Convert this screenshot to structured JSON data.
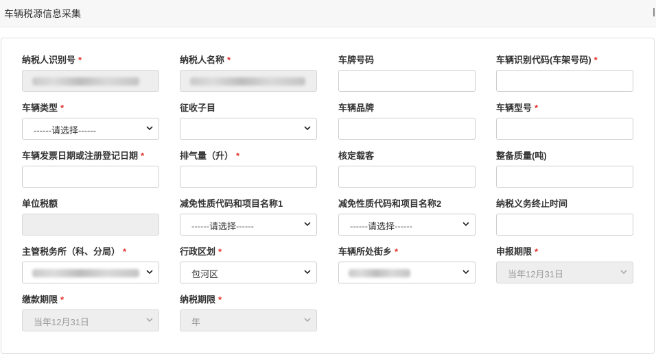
{
  "header": {
    "title": "车辆税源信息采集"
  },
  "required_mark": "*",
  "fields": {
    "taxpayer_id": {
      "label": "纳税人识别号",
      "required": true
    },
    "taxpayer_name": {
      "label": "纳税人名称",
      "required": true
    },
    "plate_no": {
      "label": "车牌号码",
      "required": false
    },
    "vin": {
      "label": "车辆识别代码(车架号码)",
      "required": true
    },
    "vehicle_type": {
      "label": "车辆类型",
      "required": true,
      "value": "------请选择------"
    },
    "levy_sub_item": {
      "label": "征收子目",
      "required": false,
      "value": ""
    },
    "vehicle_brand": {
      "label": "车辆品牌",
      "required": false
    },
    "vehicle_model": {
      "label": "车辆型号",
      "required": true
    },
    "invoice_date": {
      "label": "车辆发票日期或注册登记日期",
      "required": true
    },
    "displacement": {
      "label": "排气量（升）",
      "required": true
    },
    "passengers": {
      "label": "核定载客",
      "required": false
    },
    "curb_weight": {
      "label": "整备质量(吨)",
      "required": false
    },
    "unit_tax": {
      "label": "单位税额",
      "required": false
    },
    "exemption1": {
      "label": "减免性质代码和项目名称1",
      "required": false,
      "value": "------请选择------"
    },
    "exemption2": {
      "label": "减免性质代码和项目名称2",
      "required": false,
      "value": "------请选择------"
    },
    "obligation_end": {
      "label": "纳税义务终止时间",
      "required": false
    },
    "tax_office": {
      "label": "主管税务所（科、分局）",
      "required": true
    },
    "district": {
      "label": "行政区划",
      "required": true,
      "value": "包河区"
    },
    "street": {
      "label": "车辆所处街乡",
      "required": true
    },
    "declare_period": {
      "label": "申报期限",
      "required": true,
      "value": "当年12月31日"
    },
    "payment_period": {
      "label": "缴款期限",
      "required": true,
      "value": "当年12月31日"
    },
    "tax_period": {
      "label": "纳税期限",
      "required": true,
      "value": "年"
    }
  },
  "icons": {
    "dropdown": "chevron-down-icon"
  },
  "colors": {
    "required": "#e0312b",
    "border": "#cccccc",
    "disabled_bg": "#eeeeee"
  }
}
